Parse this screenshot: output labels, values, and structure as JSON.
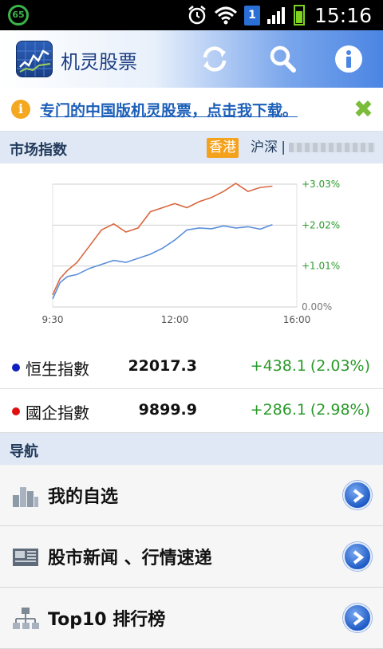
{
  "status_bar": {
    "notification_badge": "65",
    "sim": "1",
    "time": "15:16"
  },
  "app_bar": {
    "title": "机灵股票",
    "icons": [
      "refresh-icon",
      "search-icon",
      "info-icon"
    ]
  },
  "banner": {
    "text": "专门的中国版机灵股票，点击我下载",
    "suffix": "。",
    "close": "✖"
  },
  "market": {
    "header": "市场指数",
    "tab_hk": "香港",
    "tab_sz": "沪深",
    "separator": "|"
  },
  "chart_data": {
    "type": "line",
    "x_ticks": [
      "9:30",
      "12:00",
      "16:00"
    ],
    "y_ticks": [
      "0.00%",
      "+1.01%",
      "+2.02%",
      "+3.03%"
    ],
    "ylim": [
      0,
      3.03
    ],
    "series": [
      {
        "name": "恒生指數",
        "color": "#5b8fd9",
        "x": [
          0,
          0.03,
          0.06,
          0.1,
          0.15,
          0.2,
          0.25,
          0.3,
          0.35,
          0.4,
          0.45,
          0.5,
          0.55,
          0.6,
          0.65,
          0.7,
          0.75,
          0.8,
          0.85,
          0.9
        ],
        "values": [
          0.2,
          0.6,
          0.75,
          0.8,
          0.95,
          1.05,
          1.15,
          1.1,
          1.2,
          1.3,
          1.45,
          1.65,
          1.9,
          1.95,
          1.93,
          2.0,
          1.95,
          1.98,
          1.92,
          2.03
        ]
      },
      {
        "name": "國企指數",
        "color": "#d9673f",
        "x": [
          0,
          0.03,
          0.06,
          0.1,
          0.15,
          0.2,
          0.25,
          0.3,
          0.35,
          0.4,
          0.45,
          0.5,
          0.55,
          0.6,
          0.65,
          0.7,
          0.75,
          0.8,
          0.85,
          0.9
        ],
        "values": [
          0.3,
          0.7,
          0.9,
          1.1,
          1.5,
          1.9,
          2.05,
          1.85,
          1.95,
          2.35,
          2.45,
          2.55,
          2.45,
          2.6,
          2.7,
          2.85,
          3.05,
          2.85,
          2.95,
          2.98
        ]
      }
    ]
  },
  "indices": [
    {
      "name": "恒生指數",
      "dot_color": "#1020c0",
      "value": "22017.3",
      "change": "+438.1",
      "percent": "(2.03%)"
    },
    {
      "name": "國企指數",
      "dot_color": "#e01010",
      "value": "9899.9",
      "change": "+286.1",
      "percent": "(2.98%)"
    }
  ],
  "nav": {
    "header": "导航",
    "items": [
      {
        "label": "我的自选",
        "icon": "bar-chart-icon"
      },
      {
        "label": "股市新闻 、行情速递",
        "icon": "newspaper-icon"
      },
      {
        "label": "Top10 排行榜",
        "icon": "hierarchy-icon"
      }
    ]
  }
}
